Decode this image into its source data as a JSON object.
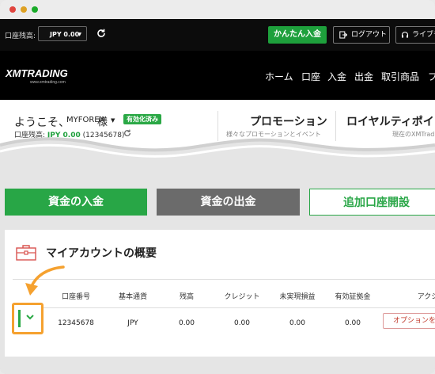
{
  "topbar": {
    "balance_label": "口座残高:",
    "balance_select": "JPY 0.00",
    "deposit_button": "かんたん入金",
    "logout_button": "ログアウト",
    "chat_button": "ライブチ"
  },
  "navbar": {
    "logo": "XMTRADING",
    "logo_sub": "www.xmtrading.com",
    "items": [
      "ホーム",
      "口座",
      "入金",
      "出金",
      "取引商品",
      "プ"
    ]
  },
  "welcome": {
    "title": "ようこそ、",
    "name": "MYFOREX",
    "sama": "様",
    "verified_badge": "有効化済み",
    "balance_label": "口座残高:",
    "balance_value": "JPY 0.00",
    "account_number": "(12345678)",
    "promo_title": "プロモーション",
    "promo_sub": "様々なプロモーションとイベント",
    "royal_title": "ロイヤルティポイン",
    "royal_sub": "現在のXMTradi"
  },
  "actions": {
    "deposit": "資金の入金",
    "withdraw": "資金の出金",
    "add_account": "追加口座開設"
  },
  "accounts": {
    "title": "マイアカウントの概要",
    "columns": [
      "口座番号",
      "基本通貨",
      "残高",
      "クレジット",
      "未実現損益",
      "有効証拠金",
      "アクシ"
    ],
    "row": [
      "12345678",
      "JPY",
      "0.00",
      "0.00",
      "0.00",
      "0.00"
    ],
    "options_button": "オプションを"
  },
  "colors": {
    "green": "#28a646",
    "orange": "#f5a12f",
    "dark": "#000000"
  }
}
